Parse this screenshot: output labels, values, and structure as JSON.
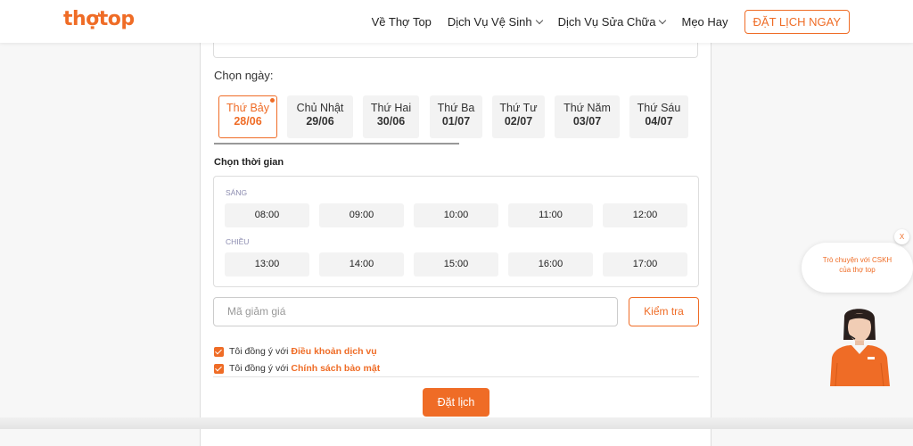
{
  "header": {
    "logo": "thợtop",
    "nav": [
      {
        "label": "Về Thợ Top",
        "dropdown": false
      },
      {
        "label": "Dịch Vụ Vệ Sinh",
        "dropdown": true
      },
      {
        "label": "Dịch Vụ Sửa Chữa",
        "dropdown": true
      },
      {
        "label": "Mẹo Hay",
        "dropdown": false
      }
    ],
    "cta_label": "ĐẶT LỊCH NGAY"
  },
  "form": {
    "date_label": "Chọn ngày:",
    "days": [
      {
        "weekday": "Thứ Bảy",
        "date": "28/06",
        "selected": true
      },
      {
        "weekday": "Chủ Nhật",
        "date": "29/06",
        "selected": false
      },
      {
        "weekday": "Thứ Hai",
        "date": "30/06",
        "selected": false
      },
      {
        "weekday": "Thứ Ba",
        "date": "01/07",
        "selected": false
      },
      {
        "weekday": "Thứ Tư",
        "date": "02/07",
        "selected": false
      },
      {
        "weekday": "Thứ Năm",
        "date": "03/07",
        "selected": false
      },
      {
        "weekday": "Thứ Sáu",
        "date": "04/07",
        "selected": false
      }
    ],
    "time_label": "Chọn thời gian",
    "morning_label": "SÁNG",
    "morning_slots": [
      "08:00",
      "09:00",
      "10:00",
      "11:00",
      "12:00"
    ],
    "afternoon_label": "CHIỀU",
    "afternoon_slots": [
      "13:00",
      "14:00",
      "15:00",
      "16:00",
      "17:00"
    ],
    "coupon_placeholder": "Mã giảm giá",
    "check_label": "Kiểm tra",
    "agree_prefix": "Tôi đồng ý với",
    "terms_link": "Điều khoản dịch vụ",
    "privacy_link": "Chính sách bảo mật",
    "submit_label": "Đặt lịch"
  },
  "chat": {
    "line1": "Trò chuyện với CSKH",
    "line2": "của thợ top",
    "close": "X"
  },
  "colors": {
    "accent": "#ef6c26",
    "period_label": "#8c8cb0",
    "slot_bg": "#f3f3f3"
  }
}
